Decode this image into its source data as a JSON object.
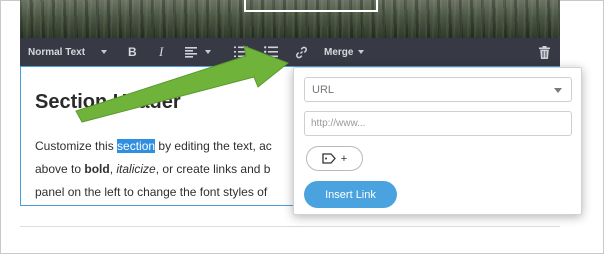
{
  "toolbar": {
    "text_style_label": "Normal Text",
    "merge_label": "Merge",
    "icons": [
      "bold-icon",
      "italic-icon",
      "align-icon",
      "ordered-list-icon",
      "unordered-list-icon",
      "link-icon",
      "trash-icon"
    ],
    "bold_glyph": "B",
    "italic_glyph": "I"
  },
  "content": {
    "heading": "Section Header",
    "line1_before": "Customize this ",
    "line1_selected": "section",
    "line1_after": " by editing the text, ac",
    "line2_before": "above to ",
    "line2_bold": "bold",
    "line2_mid": ", ",
    "line2_italic": "italicize",
    "line2_after": ", or create links and b",
    "line3": "panel on the left to change the font styles of"
  },
  "link_popup": {
    "type_select_value": "URL",
    "url_placeholder": "http://www...",
    "tag_button_label": "+",
    "insert_button_label": "Insert Link"
  },
  "colors": {
    "toolbar_bg": "#373a45",
    "selection": "#2f8fe0",
    "editor_border": "#4a9fd9",
    "insert_button": "#4aa3df",
    "arrow": "#6fb33a"
  }
}
